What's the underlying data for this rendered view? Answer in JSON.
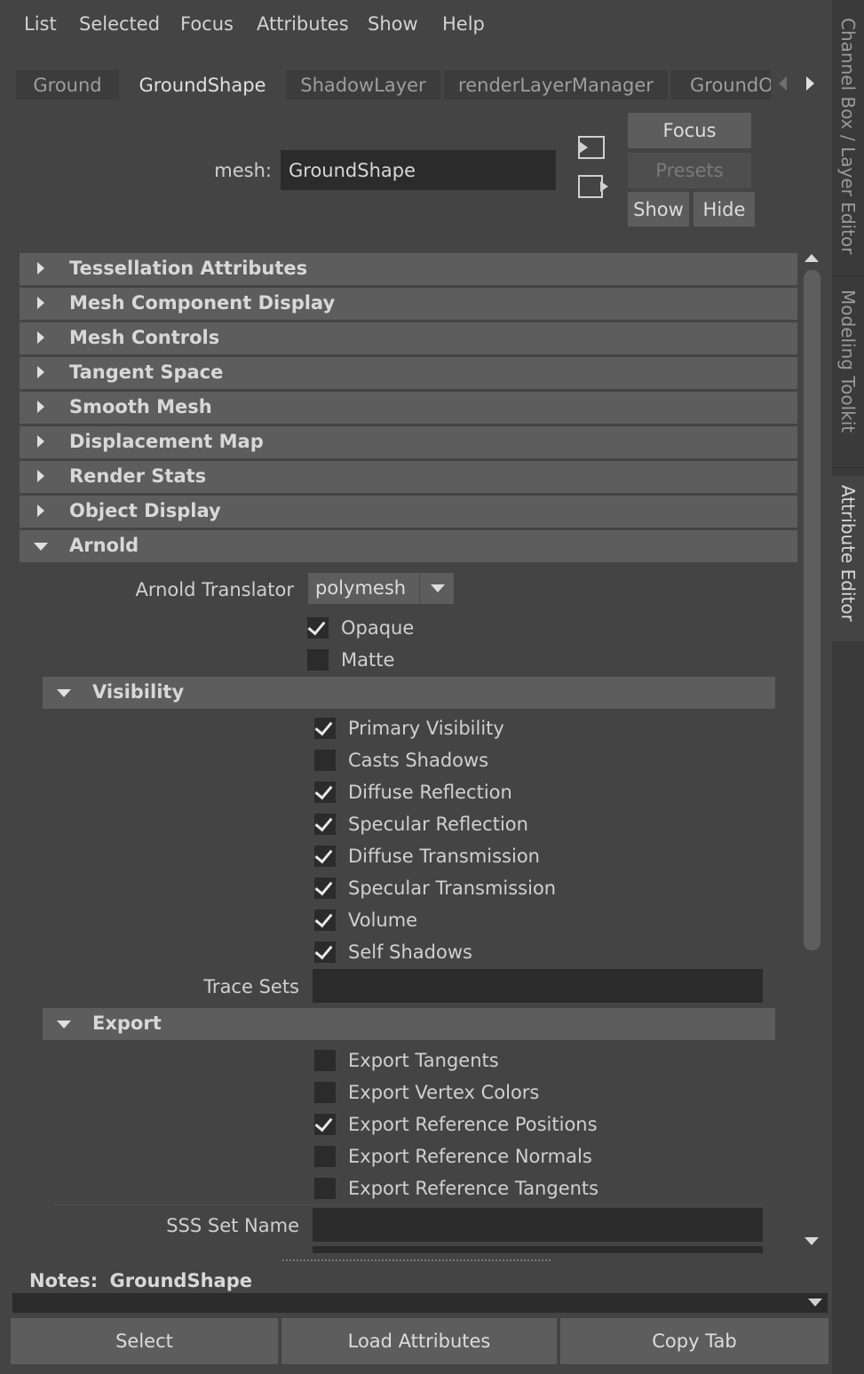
{
  "menu": [
    "List",
    "Selected",
    "Focus",
    "Attributes",
    "Show",
    "Help"
  ],
  "tabs": [
    {
      "label": "Ground",
      "active": false
    },
    {
      "label": "GroundShape",
      "active": true
    },
    {
      "label": "ShadowLayer",
      "active": false
    },
    {
      "label": "renderLayerManager",
      "active": false
    },
    {
      "label": "GroundO",
      "active": false
    }
  ],
  "side_tabs": [
    {
      "label": "Channel Box / Layer Editor",
      "active": false
    },
    {
      "label": "Modeling Toolkit",
      "active": false
    },
    {
      "label": "Attribute Editor",
      "active": true
    }
  ],
  "header": {
    "node_type_label": "mesh:",
    "node_name": "GroundShape",
    "focus_label": "Focus",
    "presets_label": "Presets",
    "show_label": "Show",
    "hide_label": "Hide"
  },
  "sections": [
    {
      "label": "Tessellation Attributes",
      "expanded": false
    },
    {
      "label": "Mesh Component Display",
      "expanded": false
    },
    {
      "label": "Mesh Controls",
      "expanded": false
    },
    {
      "label": "Tangent Space",
      "expanded": false
    },
    {
      "label": "Smooth Mesh",
      "expanded": false
    },
    {
      "label": "Displacement Map",
      "expanded": false
    },
    {
      "label": "Render Stats",
      "expanded": false
    },
    {
      "label": "Object Display",
      "expanded": false
    },
    {
      "label": "Arnold",
      "expanded": true
    }
  ],
  "arnold": {
    "translator_label": "Arnold Translator",
    "translator_value": "polymesh",
    "opaque": {
      "label": "Opaque",
      "checked": true
    },
    "matte": {
      "label": "Matte",
      "checked": false
    },
    "visibility": {
      "label": "Visibility",
      "items": [
        {
          "label": "Primary Visibility",
          "checked": true
        },
        {
          "label": "Casts Shadows",
          "checked": false
        },
        {
          "label": "Diffuse Reflection",
          "checked": true
        },
        {
          "label": "Specular Reflection",
          "checked": true
        },
        {
          "label": "Diffuse Transmission",
          "checked": true
        },
        {
          "label": "Specular Transmission",
          "checked": true
        },
        {
          "label": "Volume",
          "checked": true
        },
        {
          "label": "Self Shadows",
          "checked": true
        }
      ],
      "trace_sets_label": "Trace Sets",
      "trace_sets_value": ""
    },
    "export": {
      "label": "Export",
      "items": [
        {
          "label": "Export Tangents",
          "checked": false
        },
        {
          "label": "Export Vertex Colors",
          "checked": false
        },
        {
          "label": "Export Reference Positions",
          "checked": true
        },
        {
          "label": "Export Reference Normals",
          "checked": false
        },
        {
          "label": "Export Reference Tangents",
          "checked": false
        }
      ]
    },
    "sss_set_name_label": "SSS Set Name",
    "sss_set_name_value": ""
  },
  "notes": {
    "label": "Notes:",
    "node": "GroundShape"
  },
  "footer": {
    "select_label": "Select",
    "load_label": "Load Attributes",
    "copy_label": "Copy Tab"
  }
}
